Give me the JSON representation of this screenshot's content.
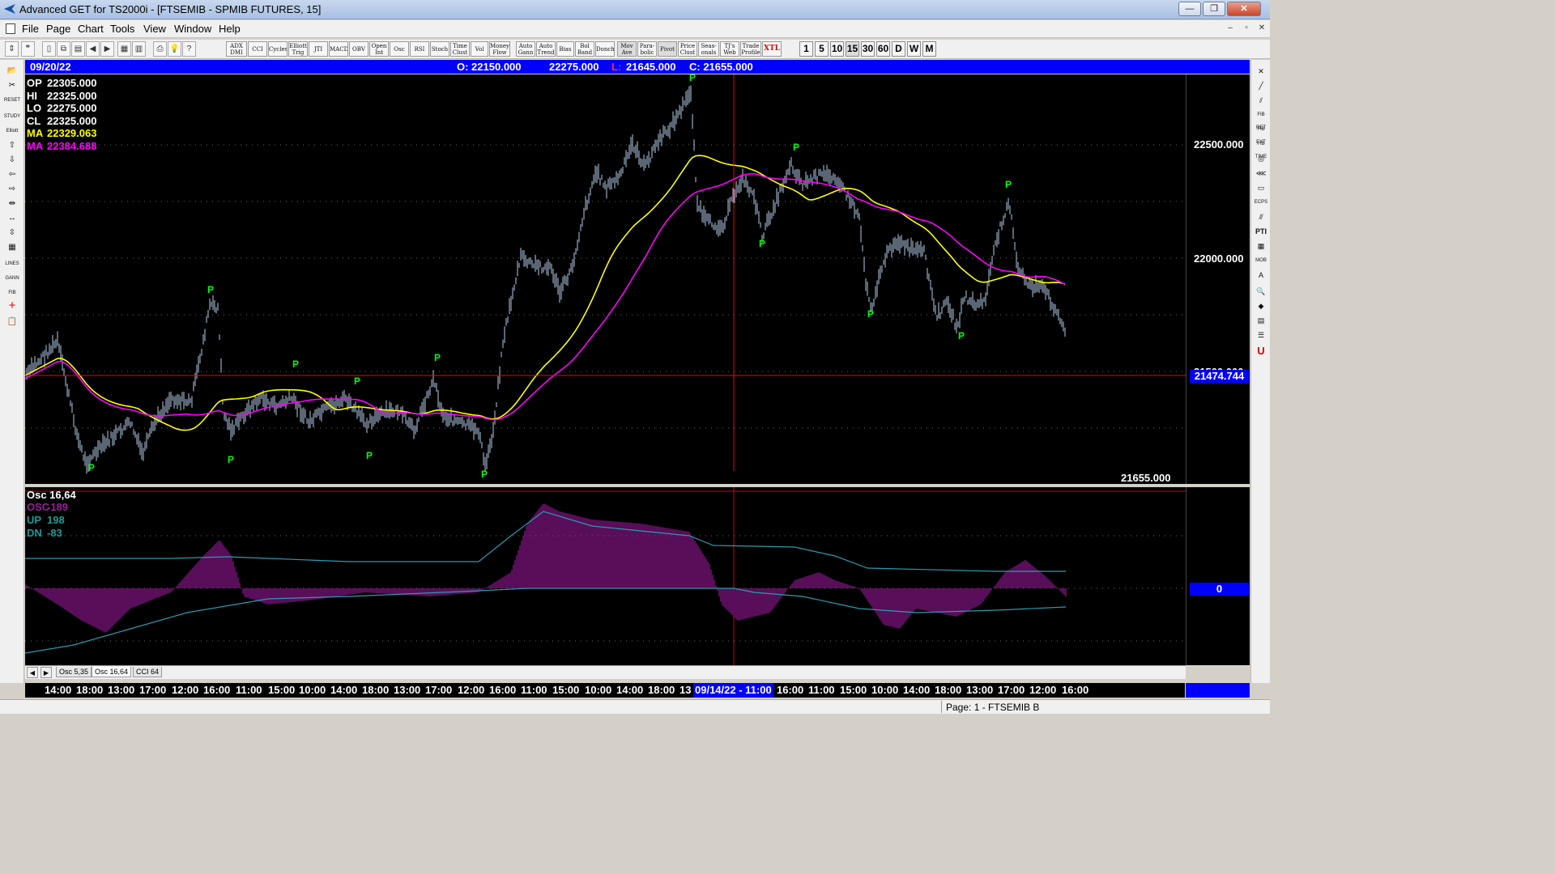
{
  "window": {
    "title": "Advanced GET for TS2000i - [FTSEMIB - SPMIB FUTURES, 15]",
    "minimize": "—",
    "restore": "❐",
    "close": "✕"
  },
  "menu": {
    "items": [
      "File",
      "Page",
      "Chart",
      "Tools",
      "View",
      "Window",
      "Help"
    ],
    "mdi_min": "–",
    "mdi_restore": "▫",
    "mdi_close": "✕"
  },
  "toolbar": {
    "study_buttons": [
      {
        "label": "ADX\nDMI"
      },
      {
        "label": "CCI"
      },
      {
        "label": "Cycles"
      },
      {
        "label": "Elliott\nTrig"
      },
      {
        "label": "JTI"
      },
      {
        "label": "MACD"
      },
      {
        "label": "OBV"
      },
      {
        "label": "Open\nInt"
      },
      {
        "label": "Osc"
      },
      {
        "label": "RSI"
      },
      {
        "label": "Stoch"
      },
      {
        "label": "Time\nClust"
      },
      {
        "label": "Vol"
      },
      {
        "label": "Money\nFlow"
      },
      {
        "label": "Auto\nGann"
      },
      {
        "label": "Auto\nTrend"
      },
      {
        "label": "Bias"
      },
      {
        "label": "Bol\nBand"
      },
      {
        "label": "Donch"
      },
      {
        "label": "Mov\nAve"
      },
      {
        "label": "Para-\nbolic"
      },
      {
        "label": "Pivot"
      },
      {
        "label": "Price\nClust"
      },
      {
        "label": "Seas-\nonals"
      },
      {
        "label": "TJ's\nWeb"
      },
      {
        "label": "Trade\nProfile"
      },
      {
        "label": "XTL"
      }
    ],
    "timeframes": [
      "1",
      "5",
      "10",
      "15",
      "30",
      "60",
      "D",
      "W",
      "M"
    ],
    "active_timeframe": "15"
  },
  "infobar": {
    "date": "09/20/22",
    "open": "O: 22150.000",
    "high": "22275.000",
    "low_prefix": "L:",
    "low": "21645.000",
    "close": "C: 21655.000"
  },
  "price_panel": {
    "readouts": [
      {
        "label": "OP",
        "value": "22305.000",
        "color": "#ffffff"
      },
      {
        "label": "HI",
        "value": "22325.000",
        "color": "#ffffff"
      },
      {
        "label": "LO",
        "value": "22275.000",
        "color": "#ffffff"
      },
      {
        "label": "CL",
        "value": "22325.000",
        "color": "#ffffff"
      },
      {
        "label": "MA",
        "value": "22329.063",
        "color": "#ffff00"
      },
      {
        "label": "MA",
        "value": "22384.688",
        "color": "#ff00ff"
      }
    ],
    "axis_labels": [
      "22500.000",
      "22000.000",
      "21500.000"
    ],
    "cursor_price": "21474.744",
    "last_close": "21655.000",
    "pivot_marker": "P",
    "colors": {
      "bars": "#b4cce8",
      "ma_fast": "#ffff00",
      "ma_slow": "#ff00ff",
      "pivot": "#00ff00",
      "cursor": "#ff0000"
    }
  },
  "osc_panel": {
    "title": "Osc 16,64",
    "readouts": [
      {
        "label": "OSC",
        "value": "-189",
        "color": "#9b1e9b"
      },
      {
        "label": "UP",
        "value": "198",
        "color": "#1a9a9a"
      },
      {
        "label": "DN",
        "value": "-83",
        "color": "#1a9a9a"
      }
    ],
    "zero_label": "0",
    "colors": {
      "histogram": "#b01cb0",
      "bands": "#2a9ab0"
    }
  },
  "tabs": {
    "prev": "◀",
    "next": "▶",
    "items": [
      "Osc 5,35",
      "Osc 16,64",
      "CCI 64"
    ],
    "active": "Osc 16,64"
  },
  "time_axis": {
    "labels": [
      "14:00",
      "18:00",
      "13:00",
      "17:00",
      "12:00",
      "16:00",
      "11:00",
      "15:00",
      "10:00",
      "14:00",
      "18:00",
      "13:00",
      "17:00",
      "12:00",
      "16:00",
      "11:00",
      "15:00",
      "10:00",
      "14:00",
      "18:00",
      "13",
      "09/14/22 - 11:00",
      "16:00",
      "11:00",
      "15:00",
      "10:00",
      "14:00",
      "18:00",
      "13:00",
      "17:00",
      "12:00",
      "16:00"
    ]
  },
  "status": {
    "page": "Page: 1 - FTSEMIB B"
  }
}
